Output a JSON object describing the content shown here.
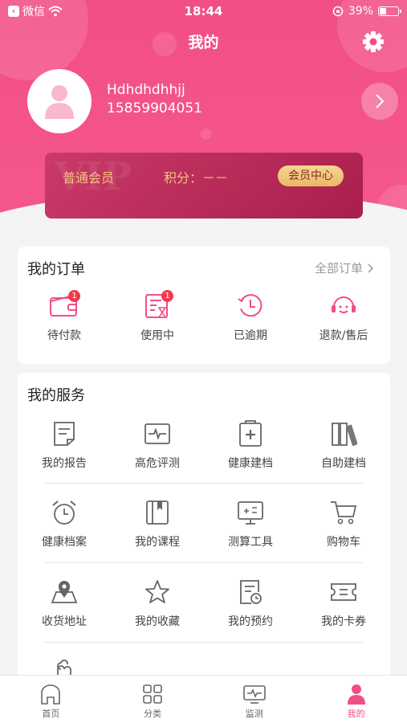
{
  "status_bar": {
    "carrier": "微信",
    "time": "18:44",
    "battery": "39%",
    "battery_level": 0.39
  },
  "header": {
    "title": "我的"
  },
  "profile": {
    "name": "Hdhdhdhhjj",
    "phone": "15859904051"
  },
  "vip": {
    "watermark": "VIP",
    "level": "普通会员",
    "points": "积分：－－",
    "center_label": "会员中心"
  },
  "orders": {
    "title": "我的订单",
    "all_label": "全部订单",
    "items": [
      {
        "label": "待付款",
        "icon": "wallet-icon",
        "badge": "1"
      },
      {
        "label": "使用中",
        "icon": "hourglass-list-icon",
        "badge": "1"
      },
      {
        "label": "已逾期",
        "icon": "clock-history-icon"
      },
      {
        "label": "退款/售后",
        "icon": "headset-icon"
      }
    ]
  },
  "services": {
    "title": "我的服务",
    "rows": [
      [
        {
          "label": "我的报告",
          "icon": "report-icon"
        },
        {
          "label": "高危评测",
          "icon": "pulse-monitor-icon"
        },
        {
          "label": "健康建档",
          "icon": "medical-file-icon"
        },
        {
          "label": "自助建档",
          "icon": "binders-icon"
        }
      ],
      [
        {
          "label": "健康档案",
          "icon": "alarm-clock-icon"
        },
        {
          "label": "我的课程",
          "icon": "bookmark-book-icon"
        },
        {
          "label": "测算工具",
          "icon": "calculator-screen-icon"
        },
        {
          "label": "购物车",
          "icon": "cart-icon"
        }
      ],
      [
        {
          "label": "收货地址",
          "icon": "map-pin-icon"
        },
        {
          "label": "我的收藏",
          "icon": "star-icon"
        },
        {
          "label": "我的预约",
          "icon": "appointment-icon"
        },
        {
          "label": "我的卡券",
          "icon": "ticket-icon"
        }
      ]
    ]
  },
  "tabbar": {
    "items": [
      {
        "label": "首页",
        "icon": "home-icon"
      },
      {
        "label": "分类",
        "icon": "grid-icon"
      },
      {
        "label": "监测",
        "icon": "monitor-icon"
      },
      {
        "label": "我的",
        "icon": "profile-icon",
        "active": true
      }
    ]
  },
  "colors": {
    "primary": "#f24e86",
    "gold": "#f2c67c",
    "badge": "#ef3b4f"
  }
}
